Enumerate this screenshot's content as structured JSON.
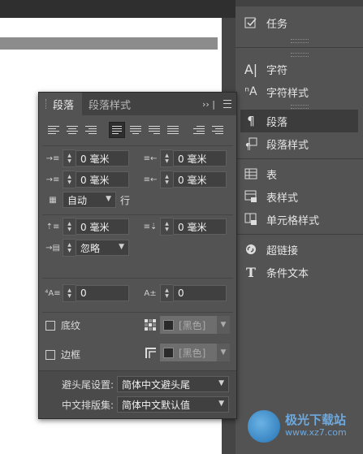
{
  "dock": {
    "items": [
      {
        "label": "任务",
        "icon": "task-icon"
      },
      {
        "label": "字符",
        "icon": "character-icon"
      },
      {
        "label": "字符样式",
        "icon": "character-styles-icon"
      },
      {
        "label": "段落",
        "icon": "paragraph-icon",
        "active": true
      },
      {
        "label": "段落样式",
        "icon": "paragraph-styles-icon"
      },
      {
        "label": "表",
        "icon": "table-icon"
      },
      {
        "label": "表样式",
        "icon": "table-styles-icon"
      },
      {
        "label": "单元格样式",
        "icon": "cell-styles-icon"
      },
      {
        "label": "超链接",
        "icon": "hyperlink-icon"
      },
      {
        "label": "条件文本",
        "icon": "conditional-text-icon"
      }
    ]
  },
  "panel": {
    "tabs": [
      {
        "label": "段落"
      },
      {
        "label": "段落样式"
      }
    ],
    "left_indent": "0 毫米",
    "right_indent": "0 毫米",
    "first_line_indent": "0 毫米",
    "last_line_indent": "0 毫米",
    "line_spacing": "自动",
    "line_unit": "行",
    "space_before": "0 毫米",
    "space_after": "0 毫米",
    "align_to_grid": "忽略",
    "drop_cap_lines": "0",
    "drop_cap_chars": "0",
    "shading_label": "底纹",
    "shading_color": "[黑色]",
    "border_label": "边框",
    "border_color": "[黑色]",
    "kinsoku_label": "避头尾设置:",
    "kinsoku_value": "简体中文避头尾",
    "mojikumi_label": "中文排版集:",
    "mojikumi_value": "简体中文默认值"
  },
  "watermark": {
    "title": "极光下载站",
    "url": "www.xz7.com"
  }
}
